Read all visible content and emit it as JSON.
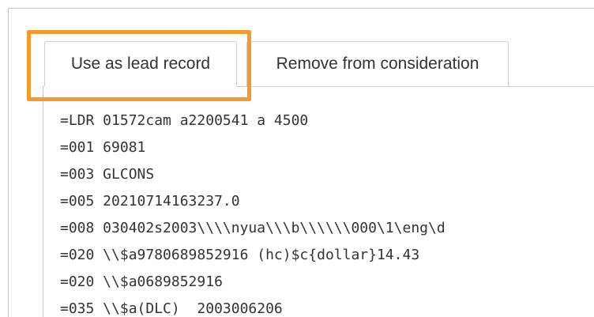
{
  "tabs": {
    "lead_record_label": "Use as lead record",
    "remove_label": "Remove from consideration"
  },
  "highlight": {
    "color": "#f39c2b",
    "target": "Use as lead record"
  },
  "marc_record": {
    "lines": [
      "=LDR 01572cam a2200541 a 4500",
      "=001 69081",
      "=003 GLCONS",
      "=005 20210714163237.0",
      "=008 030402s2003\\\\\\\\nyua\\\\\\b\\\\\\\\\\\\000\\1\\eng\\d",
      "=020 \\\\$a9780689852916 (hc)$c{dollar}14.43",
      "=020 \\\\$a0689852916",
      "=035 \\\\$a(DLC)  2003006206"
    ]
  }
}
